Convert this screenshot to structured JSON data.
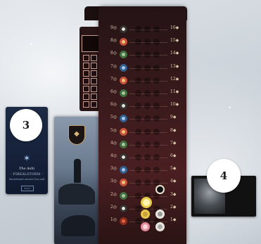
{
  "board": {
    "top_icons": [
      "pin-icon",
      "compass-icon"
    ],
    "track": [
      {
        "left": "9",
        "right": "16",
        "token_color": "#e9e2d2",
        "token_ring": "#2b2b2b"
      },
      {
        "left": "8",
        "right": "15",
        "token_color": "#e7c87a",
        "token_ring": "#c64d36"
      },
      {
        "left": "8",
        "right": "14",
        "token_color": "#a9c6a3",
        "token_ring": "#3e6b3a"
      },
      {
        "left": "7",
        "right": "13",
        "token_color": "#a9c7e6",
        "token_ring": "#2d5c8c"
      },
      {
        "left": "7",
        "right": "12",
        "token_color": "#e7c87a",
        "token_ring": "#c64d36"
      },
      {
        "left": "6",
        "right": "11",
        "token_color": "#a9c6a3",
        "token_ring": "#3e6b3a"
      },
      {
        "left": "6",
        "right": "10",
        "token_color": "#e9e2d2",
        "token_ring": "#2b2b2b"
      },
      {
        "left": "5",
        "right": "9",
        "token_color": "#a9c7e6",
        "token_ring": "#2d5c8c"
      },
      {
        "left": "5",
        "right": "8",
        "token_color": "#e7c87a",
        "token_ring": "#c64d36"
      },
      {
        "left": "4",
        "right": "7",
        "token_color": "#a9c6a3",
        "token_ring": "#3e6b3a"
      },
      {
        "left": "4",
        "right": "6",
        "token_color": "#e9e2d2",
        "token_ring": "#2b2b2b"
      },
      {
        "left": "3",
        "right": "5",
        "token_color": "#a9c7e6",
        "token_ring": "#2d5c8c"
      },
      {
        "left": "3",
        "right": "4",
        "token_color": "#e7c87a",
        "token_ring": "#c64d36"
      },
      {
        "left": "2",
        "right": "3",
        "token_color": "#a9c6a3",
        "token_ring": "#3e6b3a"
      },
      {
        "left": "2",
        "right": "2",
        "token_color": "#e9e2d2",
        "token_ring": "#2b2b2b"
      },
      {
        "left": "1",
        "right": "1",
        "token_color": "#e0653a",
        "token_ring": "#8a2b1c"
      }
    ]
  },
  "cards": {
    "card3": {
      "badge": "3",
      "title": "The Ashi",
      "subtitle": "- FIREALSTORM -",
      "subtitle2": "Snowbound ancient Sea and",
      "footer": "E.S.C."
    },
    "card4": {
      "badge": "4"
    }
  },
  "colors": {
    "board_bg": "#3a1a1c",
    "accent_gold": "#d9b57a",
    "player_yellow": "#e8c84a",
    "player_white": "#eae6e0",
    "player_pink": "#e58a9a"
  }
}
